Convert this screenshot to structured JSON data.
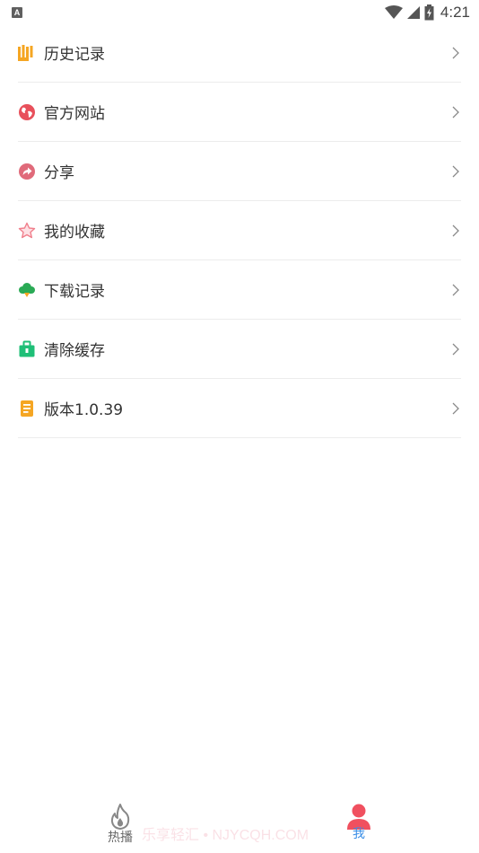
{
  "status_bar": {
    "left_icon_letter": "A",
    "time": "4:21"
  },
  "menu": [
    {
      "label": "历史记录",
      "icon": "history-icon",
      "color": "#f5a623"
    },
    {
      "label": "官方网站",
      "icon": "globe-icon",
      "color": "#e8505b"
    },
    {
      "label": "分享",
      "icon": "share-icon",
      "color": "#e06a7a"
    },
    {
      "label": "我的收藏",
      "icon": "star-icon",
      "color": "#f07f8c"
    },
    {
      "label": "下载记录",
      "icon": "cloud-download-icon",
      "color": "#2aaa55"
    },
    {
      "label": "清除缓存",
      "icon": "briefcase-icon",
      "color": "#1fbf77"
    },
    {
      "label": "版本1.0.39",
      "icon": "document-icon",
      "color": "#f5a623"
    }
  ],
  "bottom_nav": {
    "hot_label": "热播",
    "me_label": "我",
    "active_color": "#3a8ee6",
    "active_icon_color": "#f0505f"
  },
  "watermark": "乐享轻汇 • NJYCQH.COM"
}
